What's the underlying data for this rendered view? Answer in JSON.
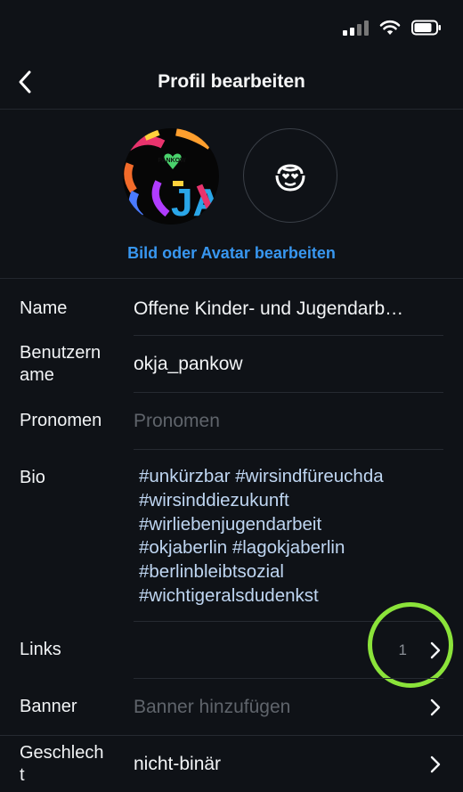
{
  "header": {
    "title": "Profil bearbeiten"
  },
  "avatar": {
    "profile_image_text_top": "PANKOW",
    "profile_image_text_letters": "JA",
    "edit_link": "Bild oder Avatar bearbeiten"
  },
  "fields": {
    "name": {
      "label": "Name",
      "value": "Offene Kinder- und Jugendarb…"
    },
    "username": {
      "label_line1": "Benutzern",
      "label_line2": "ame",
      "value": "okja_pankow"
    },
    "pronouns": {
      "label": "Pronomen",
      "placeholder": "Pronomen"
    },
    "bio": {
      "label": "Bio",
      "lines": [
        "#unkürzbar #wirsindfüreuchda",
        "#wirsinddiezukunft",
        "#wirliebenjugendarbeit",
        "#okjaberlin #lagokjaberlin",
        "#berlinbleibtsozial",
        "#wichtigeralsdudenkst"
      ]
    },
    "links": {
      "label": "Links",
      "count": "1"
    },
    "banner": {
      "label": "Banner",
      "placeholder": "Banner hinzufügen"
    },
    "gender": {
      "label_line1": "Geschlech",
      "label_line2": "t",
      "value": "nicht-binär"
    }
  },
  "colors": {
    "background": "#0f1217",
    "accent_link": "#3897f0",
    "highlight_ring": "#8be33a"
  }
}
